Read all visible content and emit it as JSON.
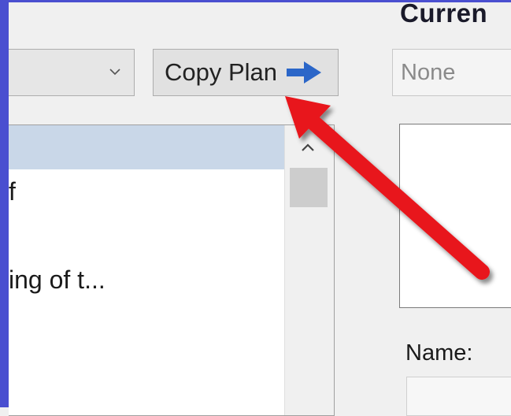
{
  "header": {
    "current_heading": "Curren"
  },
  "plan_dropdown": {
    "value": ""
  },
  "copy_plan_button": {
    "label": "Copy Plan"
  },
  "current_plan_field": {
    "value": "None"
  },
  "plan_list": {
    "items": [
      {
        "label": "",
        "selected": true
      },
      {
        "label": "f",
        "selected": false
      },
      {
        "label": "",
        "selected": false
      },
      {
        "label": "ing of t...",
        "selected": false
      }
    ]
  },
  "details": {
    "name_label": "Name:",
    "name_value": ""
  },
  "colors": {
    "accent_blue": "#2b66c8",
    "annotation_red": "#e8161c",
    "selection": "#c9d7e8"
  }
}
